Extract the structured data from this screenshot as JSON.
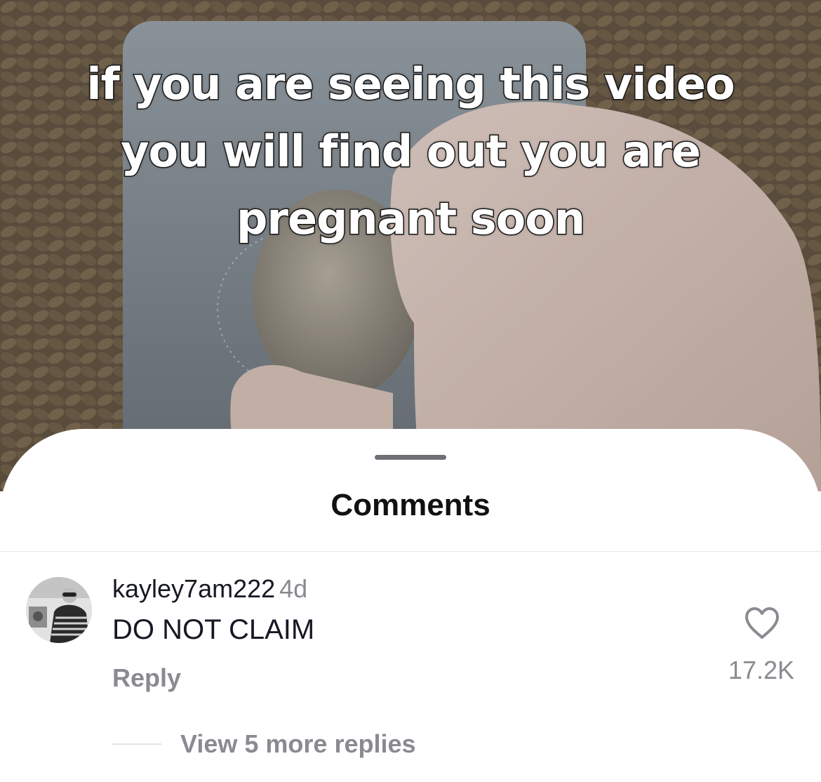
{
  "video": {
    "caption_lines": [
      "if you are seeing this video",
      "you will find out you are",
      "pregnant soon"
    ]
  },
  "comments_sheet": {
    "title": "Comments",
    "comment": {
      "username": "kayley7am222",
      "time": "4d",
      "text": "DO NOT CLAIM",
      "reply_label": "Reply",
      "like_count": "17.2K",
      "view_more_label": "View 5 more replies"
    }
  },
  "icons": {
    "like": "heart-outline-icon",
    "avatar": "user-avatar"
  },
  "colors": {
    "text_primary": "#161823",
    "text_secondary": "#8a8b91",
    "handle": "#6f6f75"
  }
}
